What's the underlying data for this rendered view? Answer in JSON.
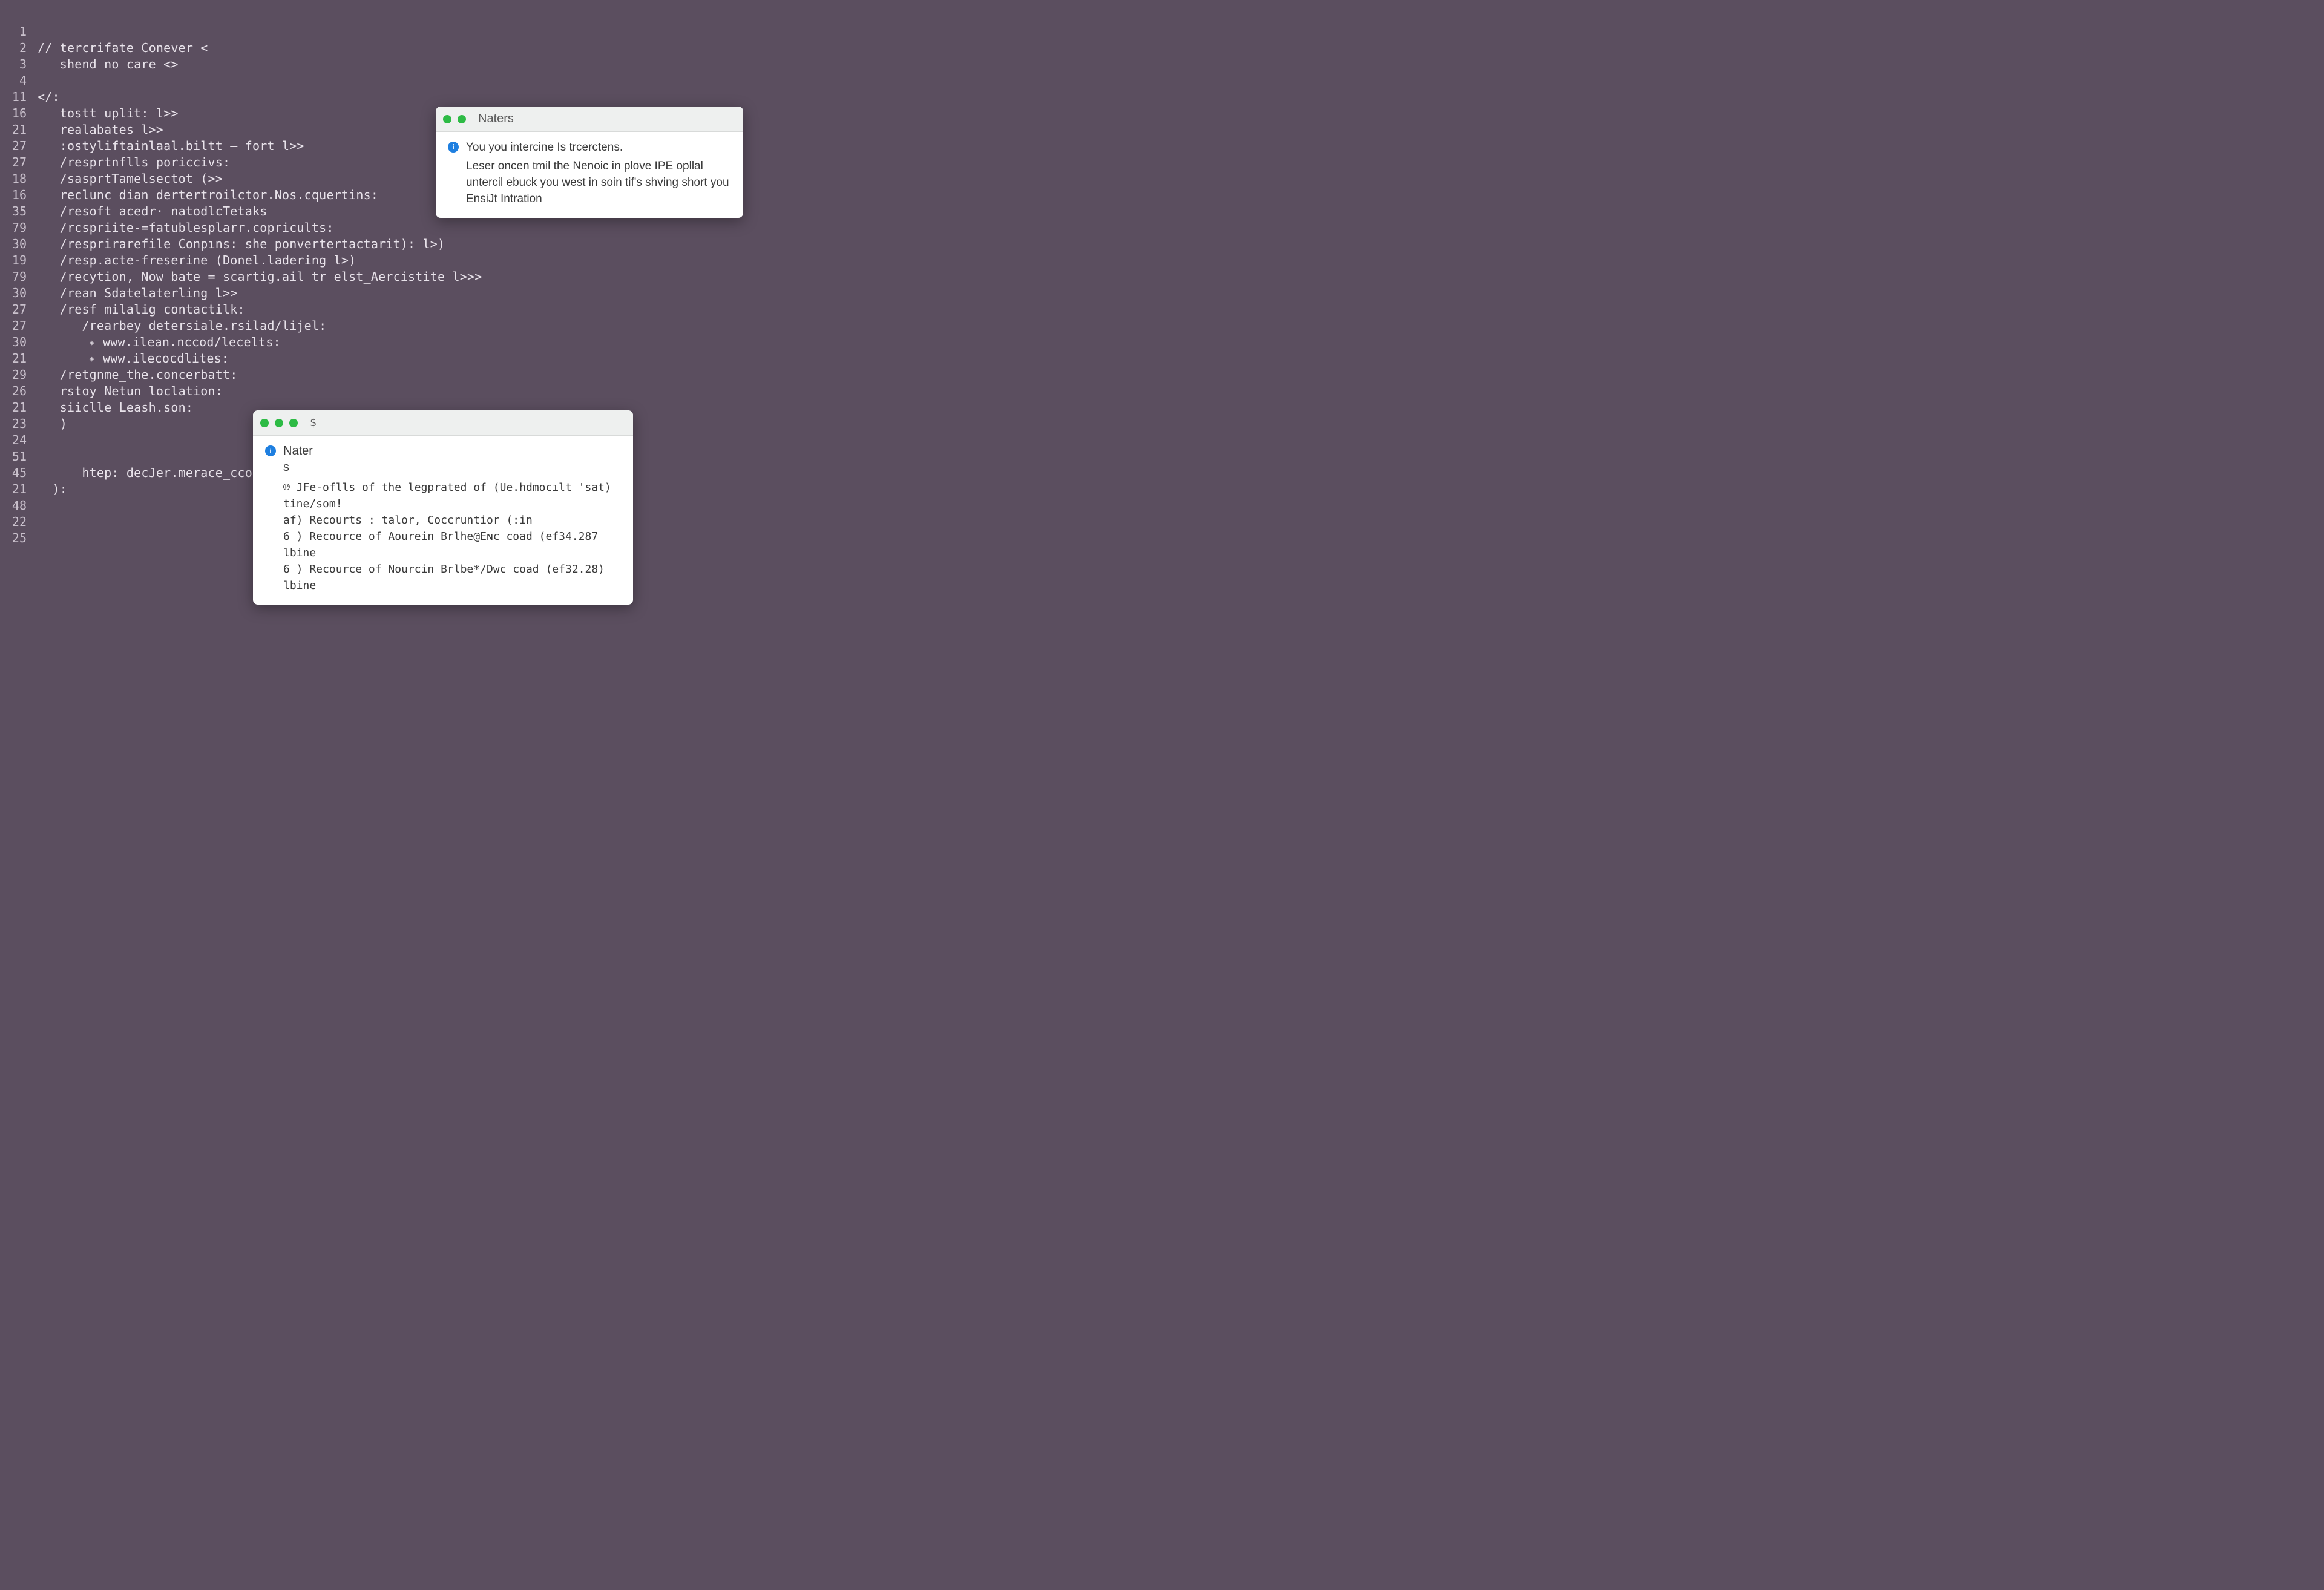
{
  "editor": {
    "lines": [
      {
        "num": "1",
        "text": ""
      },
      {
        "num": "2",
        "text": "// tercrifate Conever <"
      },
      {
        "num": "3",
        "text": "   shend no care <>"
      },
      {
        "num": "4",
        "text": ""
      },
      {
        "num": "11",
        "text": "</:"
      },
      {
        "num": "16",
        "text": "   tostt uplit: l>>"
      },
      {
        "num": "21",
        "text": "   realabates l>>"
      },
      {
        "num": "27",
        "text": "   :ostyliftainlaal.biltt – fort l>>"
      },
      {
        "num": "27",
        "text": "   /resprtnflls poriccivs:"
      },
      {
        "num": "18",
        "text": "   /sasprtTamelsectot (>>"
      },
      {
        "num": "16",
        "text": "   reclunc dian dertertroilctor.Nos.cquertins:"
      },
      {
        "num": "35",
        "text": "   /resoft acedr· natodlcTetaks"
      },
      {
        "num": "79",
        "text": "   /rcspriite-=fatublesplarr.copricults:"
      },
      {
        "num": "30",
        "text": "   /resprirarefile Conpıns: she ponvertertactarit): l>)"
      },
      {
        "num": "19",
        "text": "   /resp.acte-freserine (Donel.ladering l>)"
      },
      {
        "num": "79",
        "text": "   /recytion, Now bate = scartig.ail tr elst_Aercistite l>>>"
      },
      {
        "num": "30",
        "text": "   /rean Sdatelaterling l>>"
      },
      {
        "num": "27",
        "text": "   /resf milalig contactilk:"
      },
      {
        "num": "27",
        "text": "      /rearbey detersiale.rsilad/lijel:"
      },
      {
        "num": "30",
        "text": "       ◇ www.ilean.nccod/lecelts:"
      },
      {
        "num": "21",
        "text": "       ◇ www.ilecocdlites:"
      },
      {
        "num": "29",
        "text": "   /retgnme_the.concerbatt:"
      },
      {
        "num": "26",
        "text": "   rstoy Netun loclation:"
      },
      {
        "num": "21",
        "text": "   siiclle Leash.son:"
      },
      {
        "num": "23",
        "text": "   )"
      },
      {
        "num": "24",
        "text": ""
      },
      {
        "num": "51",
        "text": ""
      },
      {
        "num": "45",
        "text": "      htep: decJer.merace_ccofll"
      },
      {
        "num": "21",
        "text": "  ):"
      },
      {
        "num": "48",
        "text": ""
      },
      {
        "num": "22",
        "text": ""
      },
      {
        "num": "25",
        "text": ""
      }
    ]
  },
  "panelNaters": {
    "title": "Naters",
    "body_line1": "You you intercine Is trcerctens.",
    "body_rest": "Leser oncen tmil the Nenoic in plove IPE opllal untercil ebuck you west in soin tif's  shving short you EnsiJt Intration"
  },
  "panelNater": {
    "titlePrompt": "$",
    "heading": "Nater",
    "sub": "s",
    "lines": [
      "℗ JFe-oflls of the legprated of (Ue.hdmocılt 'sat) tine/som!",
      "af) Recourts : talor, Coccruntior (:in",
      "6 ) Recource of Aourein Brlhe@Eɴc coad (ef34.287 lbine",
      "6 ) Recource of Nourcin Brlbe*/Dwc coad (ef32.28) lbine"
    ]
  }
}
